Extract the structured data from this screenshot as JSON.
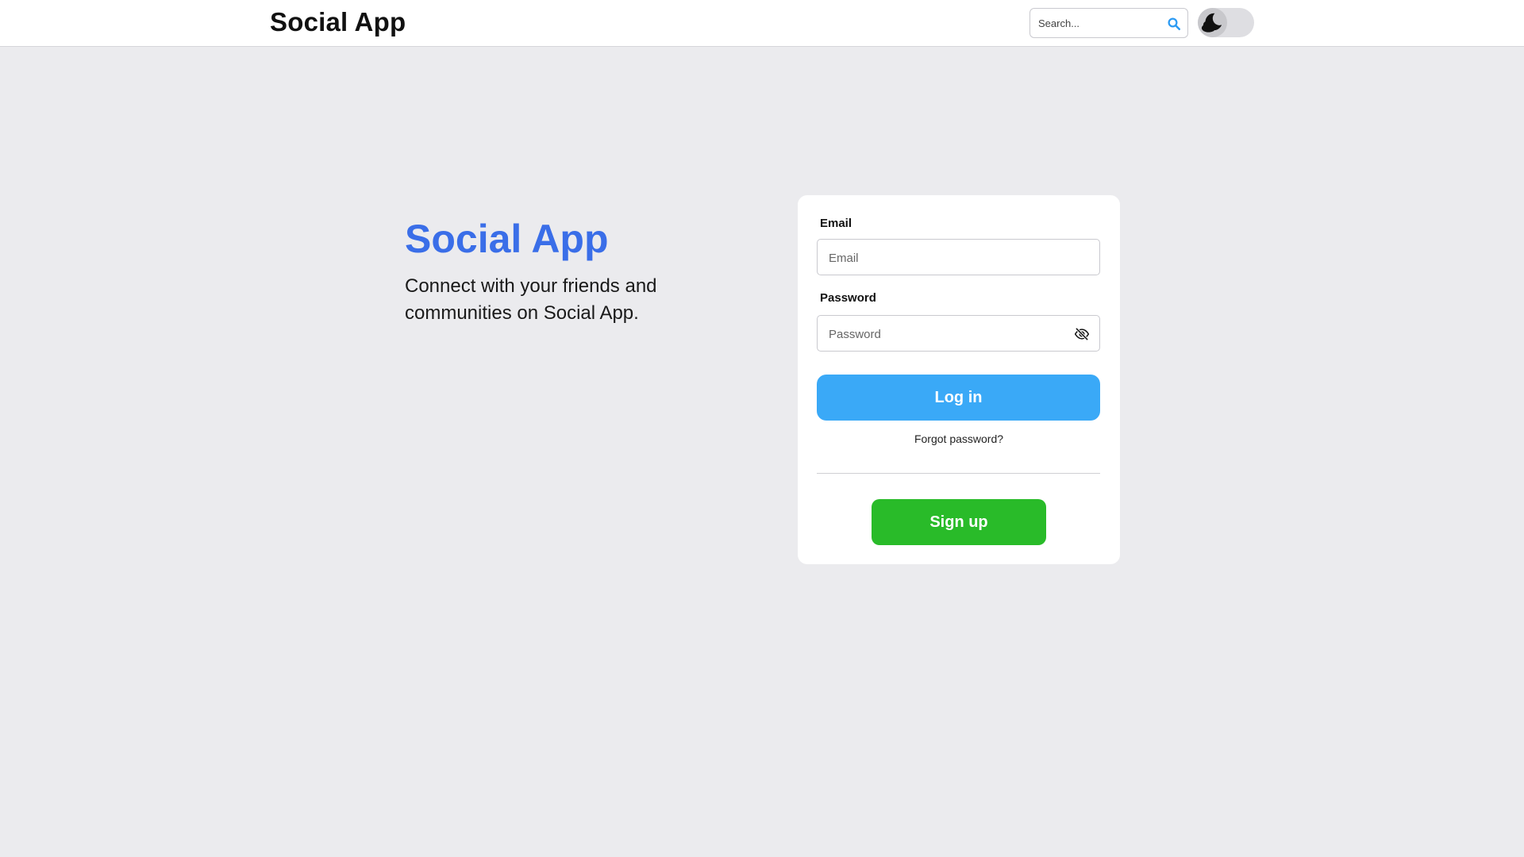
{
  "header": {
    "brand": "Social App",
    "search": {
      "placeholder": "Search...",
      "icon": "search-icon"
    },
    "theme_toggle": {
      "icon": "moon-icon",
      "state": "off"
    }
  },
  "hero": {
    "title": "Social App",
    "subtitle": "Connect with your friends and communities on Social App."
  },
  "login": {
    "email_label": "Email",
    "email_placeholder": "Email",
    "password_label": "Password",
    "password_placeholder": "Password",
    "password_toggle_icon": "eye-slash-icon",
    "login_button": "Log in",
    "forgot_link": "Forgot password?",
    "signup_button": "Sign up"
  },
  "colors": {
    "accent_title": "#3a6ee8",
    "login_button": "#3aa9f7",
    "signup_button": "#29bb29",
    "page_background": "#ebebee"
  }
}
